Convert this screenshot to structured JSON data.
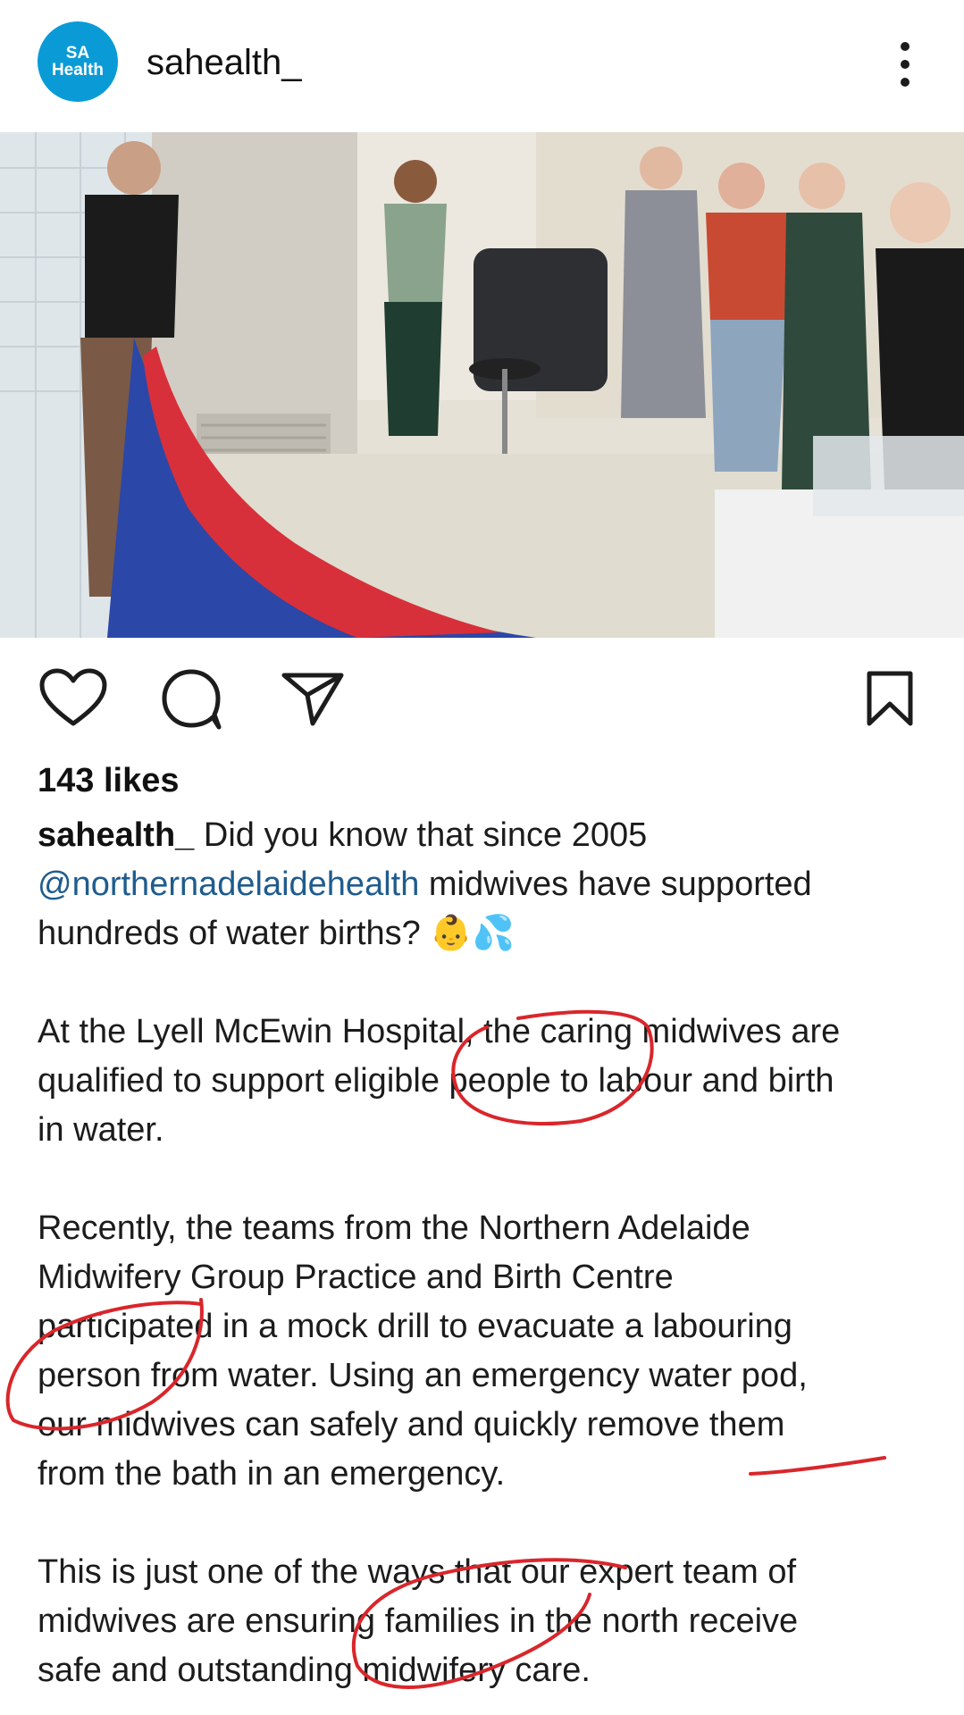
{
  "header": {
    "avatar_line1": "SA",
    "avatar_line2": "Health",
    "username": "sahealth_",
    "more_icon": "more-vertical-icon"
  },
  "actions": {
    "like_icon": "heart-icon",
    "comment_icon": "comment-icon",
    "share_icon": "send-icon",
    "save_icon": "bookmark-icon"
  },
  "likes": "143 likes",
  "caption": {
    "owner": "sahealth_",
    "intro": " Did you know that since 2005",
    "mention": "@northernadelaidehealth",
    "line2_rest": " midwives have supported",
    "line3": "hundreds of water births? 👶💦",
    "p2_l1": "At the Lyell McEwin Hospital, the caring midwives are",
    "p2_l2": "qualified to support eligible people to labour and birth",
    "p2_l3": "in water.",
    "p3_l1": "Recently, the teams from the Northern Adelaide",
    "p3_l2": "Midwifery Group Practice and Birth Centre",
    "p3_l3": "participated in a mock drill to evacuate a labouring",
    "p3_l4": "person from water. Using an emergency water pod,",
    "p3_l5": "our midwives can safely and quickly remove them",
    "p3_l6": "from the bath in an emergency.",
    "p4_l1": "This is just one of the ways that our expert team of",
    "p4_l2": "midwives are ensuring families in the north receive",
    "p4_l3": "safe and outstanding midwifery care."
  },
  "colors": {
    "brand": "#0a9bd7",
    "mention": "#1f5c8e",
    "annotation": "#d9262b"
  }
}
